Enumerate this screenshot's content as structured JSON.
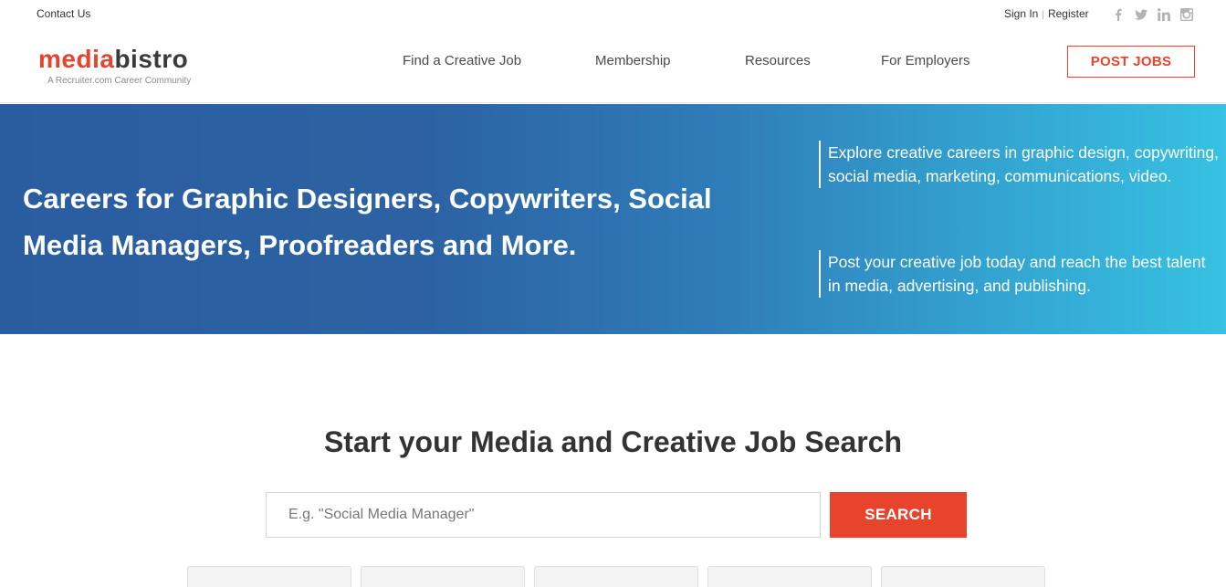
{
  "topbar": {
    "contact": "Contact Us",
    "sign_in": "Sign In",
    "separator": "|",
    "register": "Register",
    "social_icons": [
      "facebook-icon",
      "twitter-icon",
      "linkedin-icon",
      "instagram-icon"
    ]
  },
  "header": {
    "logo": {
      "part1": "media",
      "part2": "bistro",
      "tagline": "A Recruiter.com Career Community"
    },
    "nav": [
      "Find a Creative Job",
      "Membership",
      "Resources",
      "For Employers"
    ],
    "post_jobs": "POST JOBS"
  },
  "hero": {
    "title": "Careers for Graphic Designers, Copywriters, Social Media Managers, Proofreaders and More.",
    "blurb1": "Explore creative careers in graphic design, copywriting, social media, marketing, communications, video.",
    "blurb2": "Post your creative job today and reach the best talent in media, advertising, and publishing."
  },
  "search": {
    "heading": "Start your Media and Creative Job Search",
    "placeholder": "E.g. \"Social Media Manager\"",
    "value": "",
    "button": "SEARCH"
  },
  "colors": {
    "accent": "#e8432c",
    "hero_start": "#2a5da0",
    "hero_end": "#37c1e2",
    "text": "#333333"
  }
}
